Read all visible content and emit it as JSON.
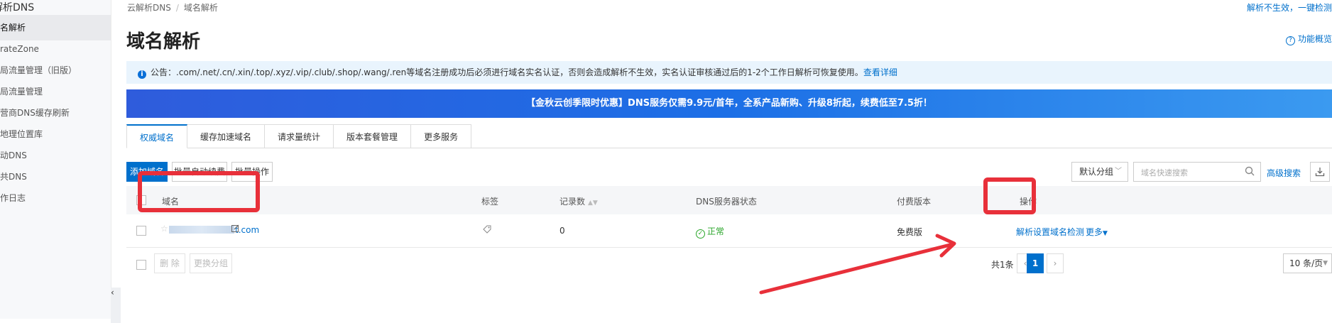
{
  "sidebar": {
    "brand": "解析DNS",
    "items": [
      {
        "label": "名解析",
        "active": true
      },
      {
        "label": "rateZone",
        "active": false
      },
      {
        "label": "局流量管理（旧版）",
        "active": false
      },
      {
        "label": "局流量管理",
        "active": false
      },
      {
        "label": "营商DNS缓存刷新",
        "active": false
      },
      {
        "label": "地理位置库",
        "active": false
      },
      {
        "label": "动DNS",
        "active": false
      },
      {
        "label": "共DNS",
        "active": false
      },
      {
        "label": "作日志",
        "active": false
      }
    ],
    "collapse_glyph": "‹"
  },
  "breadcrumb": {
    "root": "云解析DNS",
    "separator": "/",
    "current": "域名解析"
  },
  "top_link": "解析不生效，一键检测",
  "page_title": "域名解析",
  "help_link": "功能概览",
  "notice": {
    "text": "公告：.com/.net/.cn/.xin/.top/.xyz/.vip/.club/.shop/.wang/.ren等域名注册成功后必须进行域名实名认证，否则会造成解析不生效，实名认证审核通过后的1-2个工作日解析可恢复使用。",
    "link": "查看详细"
  },
  "banner": "【金秋云创季限时优惠】DNS服务仅需9.9元/首年，全系产品新购、升级8折起，续费低至7.5折！",
  "tabs": [
    {
      "label": "权威域名",
      "active": true
    },
    {
      "label": "缓存加速域名",
      "active": false
    },
    {
      "label": "请求量统计",
      "active": false
    },
    {
      "label": "版本套餐管理",
      "active": false
    },
    {
      "label": "更多服务",
      "active": false
    }
  ],
  "toolbar": {
    "add_domain": "添加域名",
    "batch_renew": "批量自动续费",
    "batch_ops": "批量操作",
    "group_select": "默认分组",
    "search_placeholder": "域名快速搜索",
    "advanced_search": "高级搜索"
  },
  "table": {
    "headers": {
      "domain": "域名",
      "tag": "标签",
      "records": "记录数",
      "dns_status": "DNS服务器状态",
      "version": "付费版本",
      "actions": "操作"
    },
    "rows": [
      {
        "domain_suffix": "t.com",
        "records": "0",
        "dns_status": "正常",
        "version": "免费版",
        "action_resolve": "解析设置",
        "action_check": "域名检测",
        "action_more": "更多"
      }
    ]
  },
  "footer": {
    "delete": "删 除",
    "change_group": "更换分组",
    "total": "共1条",
    "current_page": "1",
    "page_size": "10 条/页"
  },
  "colors": {
    "accent": "#0070cc",
    "annotation": "#e8303a",
    "status_ok": "#2aa62a"
  }
}
